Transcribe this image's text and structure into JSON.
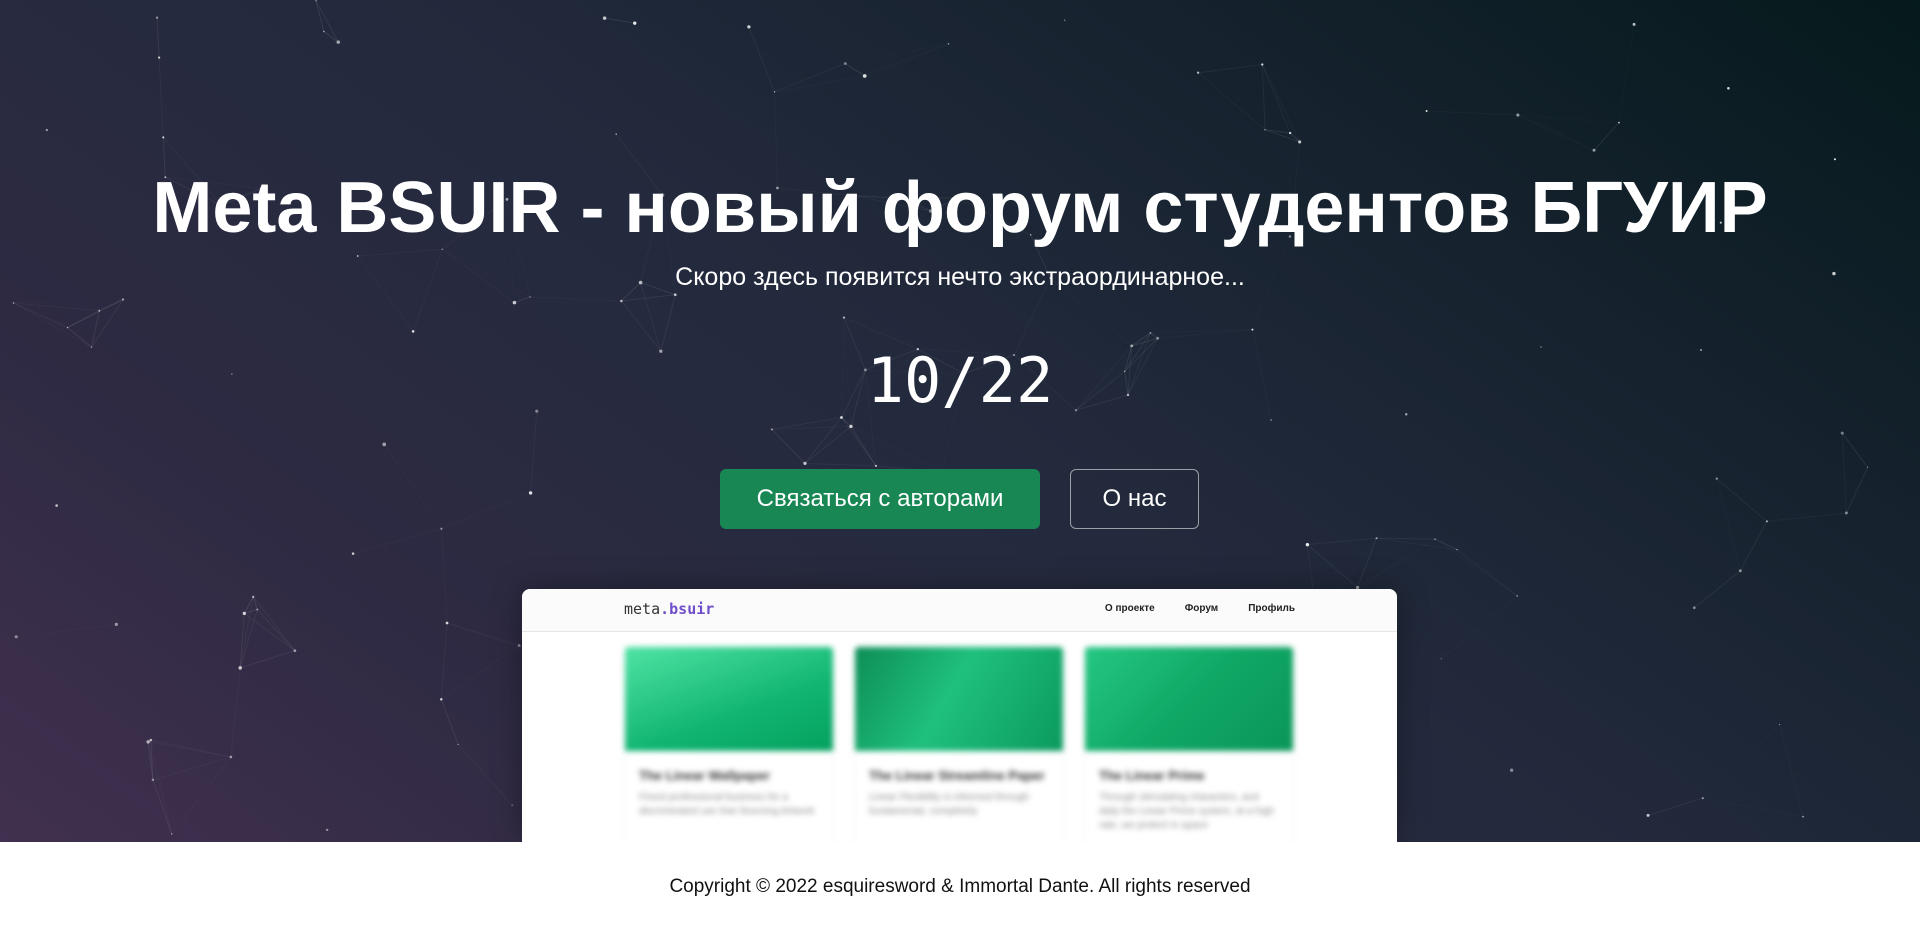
{
  "hero": {
    "title": "Meta BSUIR - новый форум студентов БГУИР",
    "subtitle": "Скоро здесь появится нечто экстраординарное...",
    "countdown": "10/22",
    "primary_button": "Связаться с авторами",
    "secondary_button": "О нас"
  },
  "preview": {
    "logo_prefix": "meta",
    "logo_dot": ".",
    "logo_suffix": "bsuir",
    "nav": [
      "О проекте",
      "Форум",
      "Профиль"
    ],
    "cards": [
      {
        "title": "The Linear Wallpaper",
        "text": "Finest professional business for a discriminated use that Stunning Artwork"
      },
      {
        "title": "The Linear Streamline Paper",
        "text": "Linear Flexibility is informed through fundamental, completely"
      },
      {
        "title": "The Linear Prime",
        "text": "Through stimulating characters, and daily the Linear Prime system, at a high rate, we protect in space"
      }
    ]
  },
  "footer": {
    "copyright": "Copyright © 2022 esquiresword & Immortal Dante. All rights reserved"
  },
  "colors": {
    "primary": "#198754",
    "accent": "#6f4ec9",
    "hero_start": "#41304f",
    "hero_end": "#051a1c"
  }
}
